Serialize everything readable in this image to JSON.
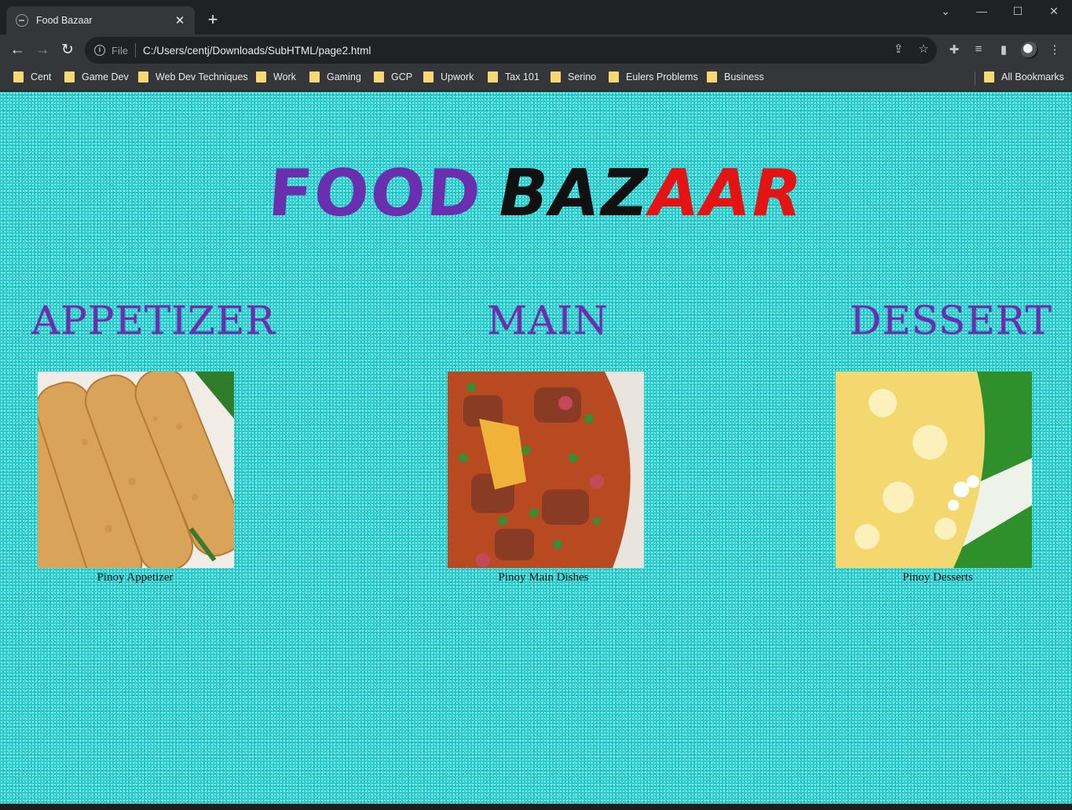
{
  "browser": {
    "tab_title": "Food Bazaar",
    "scheme_label": "File",
    "url": "C:/Users/centj/Downloads/SubHTML/page2.html",
    "bookmarks": [
      "Cent",
      "Game Dev",
      "Web Dev Techniques",
      "Work",
      "Gaming",
      "GCP",
      "Upwork",
      "Tax 101",
      "Serino",
      "Eulers Problems",
      "Business"
    ],
    "all_bookmarks": "All Bookmarks"
  },
  "page": {
    "logo": {
      "part1": "FOOD",
      "part2": "BAZ",
      "part3": "AAR"
    },
    "columns": [
      {
        "title": "APPETIZER",
        "caption": "Pinoy Appetizer"
      },
      {
        "title": "MAIN",
        "caption": "Pinoy Main Dishes"
      },
      {
        "title": "DESSERT",
        "caption": "Pinoy Desserts"
      }
    ]
  },
  "colors": {
    "background": "#28cfcf",
    "title_purple": "#6a2fae",
    "logo_red": "#e41414",
    "logo_black": "#111111"
  }
}
